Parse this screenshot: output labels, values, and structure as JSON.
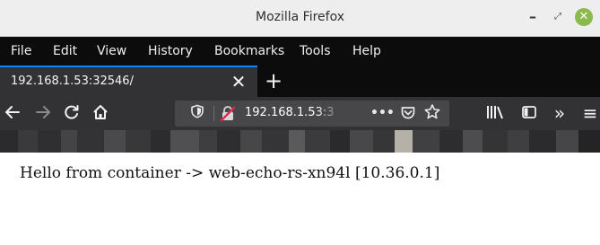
{
  "window": {
    "title": "Mozilla Firefox",
    "controls": {
      "minimize_glyph": "–",
      "maximize_glyph": "⤢",
      "close_glyph": "✕"
    }
  },
  "menu": {
    "items": [
      "File",
      "Edit",
      "View",
      "History",
      "Bookmarks",
      "Tools",
      "Help"
    ]
  },
  "tabs": [
    {
      "label": "192.168.1.53:32546/",
      "active": true
    }
  ],
  "tab_controls": {
    "close_glyph": "✕",
    "new_tab_glyph": "+"
  },
  "navbar": {
    "back_icon": "arrow-left",
    "forward_icon": "arrow-right",
    "reload_icon": "reload",
    "home_icon": "home",
    "url": "192.168.1.53:3",
    "page_actions_glyph": "•••",
    "library_icon": "library",
    "sidebar_icon": "sidebar",
    "overflow_glyph": "»",
    "menu_glyph": "≡"
  },
  "page": {
    "text": "Hello from container -> web-echo-rs-xn94l [10.36.0.1]"
  },
  "colors": {
    "menubar_bg": "#0c0c0d",
    "tab_bg": "#323234",
    "tab_accent": "#0a84ff",
    "urlbar_bg": "#474749",
    "insecure_lock_red": "#e22850",
    "close_button_green": "#8cb94d"
  }
}
